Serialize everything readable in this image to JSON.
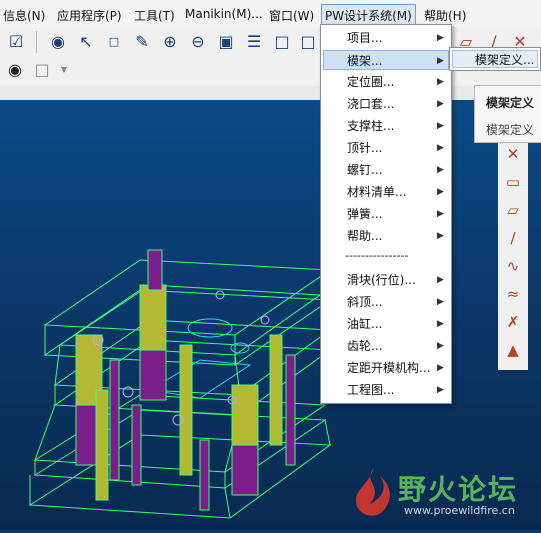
{
  "menubar": {
    "items": [
      "信息(N)",
      "应用程序(P)",
      "工具(T)",
      "Manikin(M)...",
      "窗口(W)",
      "PW设计系统(M)",
      "帮助(H)"
    ],
    "active_index": 5
  },
  "dropdown": {
    "items": [
      {
        "label": "项目...",
        "submenu": true
      },
      {
        "label": "模架...",
        "submenu": true
      },
      {
        "label": "定位圈...",
        "submenu": true
      },
      {
        "label": "浇口套...",
        "submenu": true
      },
      {
        "label": "支撑柱...",
        "submenu": true
      },
      {
        "label": "顶针...",
        "submenu": true
      },
      {
        "label": "螺钉...",
        "submenu": true
      },
      {
        "label": "材料清单...",
        "submenu": true
      },
      {
        "label": "弹簧...",
        "submenu": true
      },
      {
        "label": "帮助...",
        "submenu": true
      },
      {
        "label": "滑块(行位)...",
        "submenu": true
      },
      {
        "label": "斜顶...",
        "submenu": true
      },
      {
        "label": "油缸...",
        "submenu": true
      },
      {
        "label": "齿轮...",
        "submenu": true
      },
      {
        "label": "定距开模机构...",
        "submenu": true
      },
      {
        "label": "工程图...",
        "submenu": true
      }
    ],
    "separator": "----------------",
    "highlighted_index": 1
  },
  "submenu": {
    "items": [
      "模架定义..."
    ]
  },
  "tooltip": {
    "title": "模架定义",
    "description": "模架定义"
  },
  "watermark": {
    "text": "野火论坛",
    "url": "www.proewildfire.cn"
  },
  "colors": {
    "viewport_top": "#0c4a86",
    "viewport_bottom": "#082a52",
    "menu_highlight": "#cde2f7",
    "wireframe_green": "#3dff7a",
    "part_olive": "#b5b832",
    "part_purple": "#7a1f8a"
  },
  "icons": {
    "toolbar": [
      "window-check-icon",
      "globe-user-icon",
      "cursor-select-icon",
      "ab-text-icon",
      "pick-check-icon",
      "zoom-in-icon",
      "zoom-out-icon",
      "zoom-fit-icon",
      "layers-icon",
      "box-view-icon",
      "box-orient-icon",
      "binoculars-icon",
      "select-box-icon"
    ],
    "right_toolbar": [
      "datum-cross-icon",
      "plane-icon",
      "plane-flat-icon",
      "axis-icon",
      "curve-icon",
      "curve-analysis-icon",
      "intersect-icon",
      "point-icon"
    ]
  }
}
